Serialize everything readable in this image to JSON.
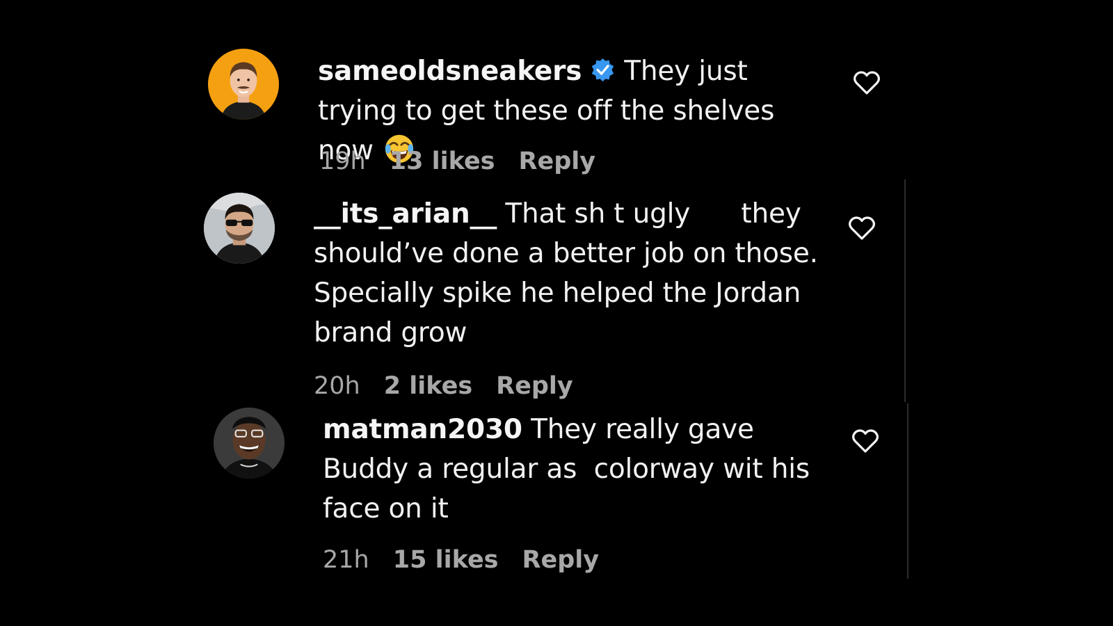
{
  "comments": [
    {
      "username": "sameoldsneakers",
      "verified": true,
      "text": "They just trying to get these off the shelves now",
      "emoji_icon": "face-with-tears-of-joy-icon",
      "time": "19h",
      "likes": "13 likes",
      "reply": "Reply"
    },
    {
      "username": "__its_arian__",
      "verified": false,
      "text": "That sh t ugly      they should’ve done a better job on those. Specially spike he helped the Jordan brand grow",
      "time": "20h",
      "likes": "2 likes",
      "reply": "Reply"
    },
    {
      "username": "matman2030",
      "verified": false,
      "text": "They really gave Buddy a regular as  colorway wit his face on it",
      "time": "21h",
      "likes": "15 likes",
      "reply": "Reply"
    }
  ],
  "icons": {
    "like": "heart-outline-icon",
    "verified": "verified-badge-icon"
  },
  "colors": {
    "background": "#000000",
    "text": "#f5f5f5",
    "meta": "#a8a8a8",
    "verified_blue": "#3897f0",
    "avatar1_bg": "#f5a011"
  }
}
